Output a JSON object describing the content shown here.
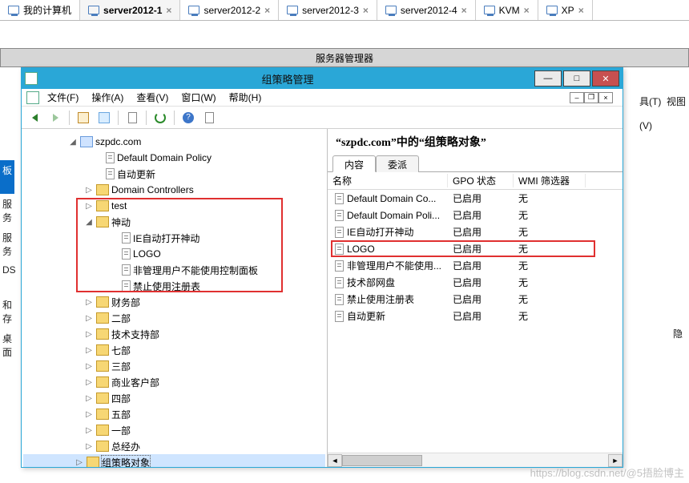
{
  "vm_tabs": [
    {
      "label": "我的计算机",
      "active": false,
      "closable": false
    },
    {
      "label": "server2012-1",
      "active": true,
      "closable": true
    },
    {
      "label": "server2012-2",
      "active": false,
      "closable": true
    },
    {
      "label": "server2012-3",
      "active": false,
      "closable": true
    },
    {
      "label": "server2012-4",
      "active": false,
      "closable": true
    },
    {
      "label": "KVM",
      "active": false,
      "closable": true
    },
    {
      "label": "XP",
      "active": false,
      "closable": true
    }
  ],
  "server_manager": {
    "title": "服务器管理器"
  },
  "hidden_right_menu": {
    "tools": "具(T)",
    "view": "视图(V)",
    "hide": "隐"
  },
  "hidden_left_sidebar": {
    "items": [
      "板",
      "服务",
      "服务",
      "DS",
      "和存",
      "桌面"
    ],
    "selected": 0
  },
  "gpmc": {
    "window_title": "组策略管理",
    "menus": {
      "file": "文件(F)",
      "action": "操作(A)",
      "view": "查看(V)",
      "window": "窗口(W)",
      "help": "帮助(H)"
    },
    "tree": {
      "domain": "szpdc.com",
      "default_policy": "Default Domain Policy",
      "auto_update": "自动更新",
      "domain_controllers": "Domain Controllers",
      "test": "test",
      "shendong": {
        "label": "神动",
        "children": [
          "IE自动打开神动",
          "LOGO",
          "非管理用户不能使用控制面板",
          "禁止使用注册表"
        ]
      },
      "others": [
        "财务部",
        "二部",
        "技术支持部",
        "七部",
        "三部",
        "商业客户部",
        "四部",
        "五部",
        "一部",
        "总经办",
        "组策略对象"
      ]
    },
    "right": {
      "heading": "“szpdc.com”中的“组策略对象”",
      "tabs": {
        "content": "内容",
        "delegation": "委派"
      },
      "columns": {
        "name": "名称",
        "state": "GPO 状态",
        "wmi": "WMI 筛选器"
      },
      "rows": [
        {
          "name": "Default Domain Co...",
          "state": "已启用",
          "wmi": "无"
        },
        {
          "name": "Default Domain Poli...",
          "state": "已启用",
          "wmi": "无"
        },
        {
          "name": "IE自动打开神动",
          "state": "已启用",
          "wmi": "无"
        },
        {
          "name": "LOGO",
          "state": "已启用",
          "wmi": "无",
          "hl": true
        },
        {
          "name": "非管理用户不能使用...",
          "state": "已启用",
          "wmi": "无"
        },
        {
          "name": "技术部网盘",
          "state": "已启用",
          "wmi": "无"
        },
        {
          "name": "禁止使用注册表",
          "state": "已启用",
          "wmi": "无"
        },
        {
          "name": "自动更新",
          "state": "已启用",
          "wmi": "无"
        }
      ]
    }
  },
  "watermark": "https://blog.csdn.net/@5捂脸博主"
}
